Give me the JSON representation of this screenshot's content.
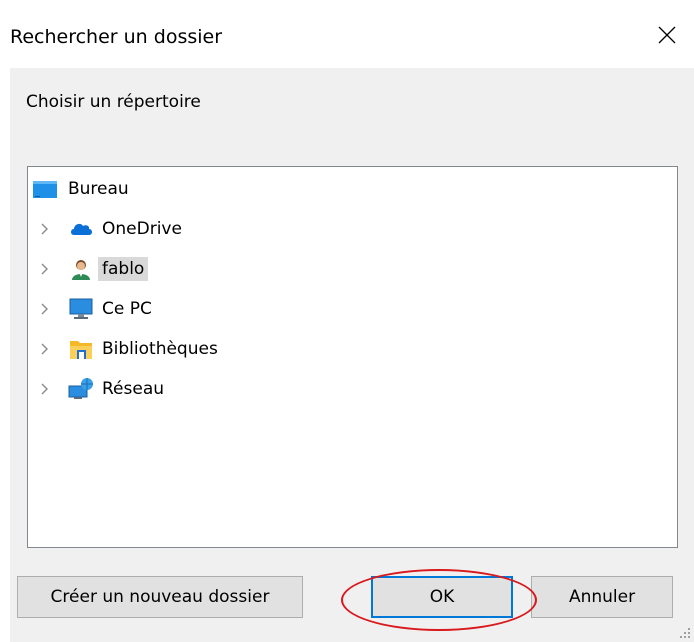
{
  "dialog": {
    "title": "Rechercher un dossier",
    "instruction": "Choisir un répertoire"
  },
  "tree": {
    "root": {
      "label": "Bureau",
      "icon": "desktop-icon"
    },
    "items": [
      {
        "label": "OneDrive",
        "icon": "onedrive-cloud-icon",
        "expandable": true,
        "selected": false
      },
      {
        "label": "fablo",
        "icon": "user-folder-icon",
        "expandable": true,
        "selected": true
      },
      {
        "label": "Ce PC",
        "icon": "computer-icon",
        "expandable": true,
        "selected": false
      },
      {
        "label": "Bibliothèques",
        "icon": "libraries-icon",
        "expandable": true,
        "selected": false
      },
      {
        "label": "Réseau",
        "icon": "network-icon",
        "expandable": true,
        "selected": false
      }
    ]
  },
  "buttons": {
    "new_folder": "Créer un nouveau dossier",
    "ok": "OK",
    "cancel": "Annuler"
  },
  "colors": {
    "accent": "#0078d7",
    "annotation": "#d9191e",
    "selection": "#d9d9d9"
  }
}
